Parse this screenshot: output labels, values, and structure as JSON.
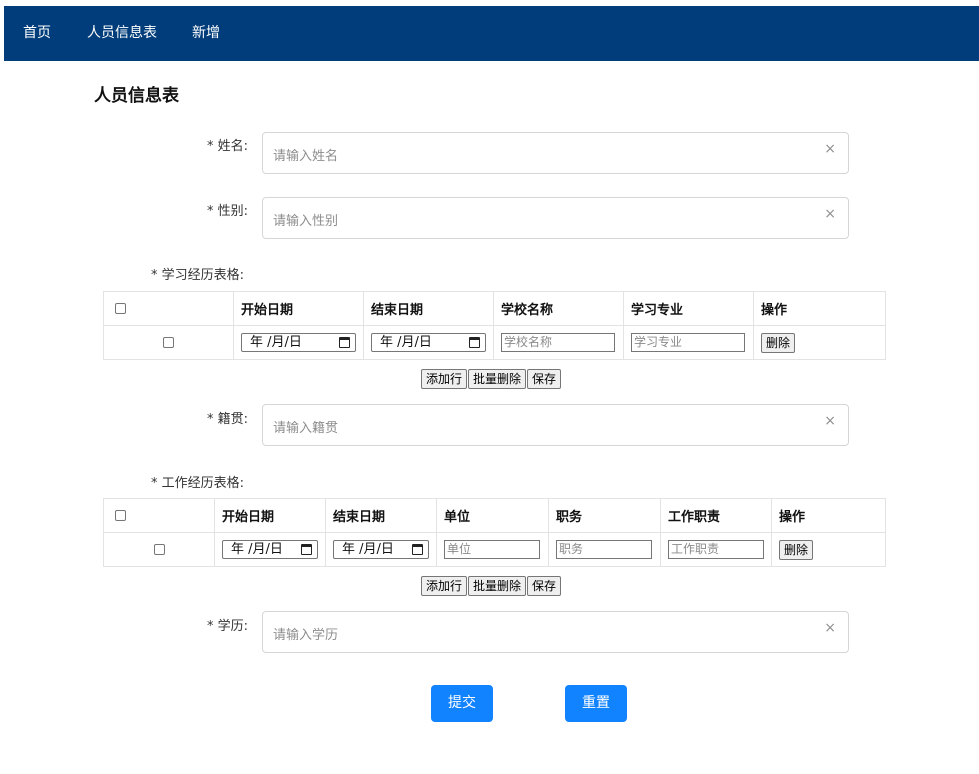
{
  "nav": {
    "home": "首页",
    "people": "人员信息表",
    "add": "新增"
  },
  "page_title": "人员信息表",
  "fields": {
    "name": {
      "label": "* 姓名:",
      "placeholder": "请输入姓名"
    },
    "gender": {
      "label": "* 性别:",
      "placeholder": "请输入性别"
    },
    "native": {
      "label": "* 籍贯:",
      "placeholder": "请输入籍贯"
    },
    "education": {
      "label": "* 学历:",
      "placeholder": "请输入学历"
    },
    "clear_icon": "×"
  },
  "study": {
    "label": "* 学习经历表格:",
    "headers": [
      "开始日期",
      "结束日期",
      "学校名称",
      "学习专业",
      "操作"
    ],
    "row": {
      "start": "年 /月/日",
      "end": "年 /月/日",
      "school_ph": "学校名称",
      "major_ph": "学习专业",
      "delete": "删除"
    }
  },
  "work": {
    "label": "* 工作经历表格:",
    "headers": [
      "开始日期",
      "结束日期",
      "单位",
      "职务",
      "工作职责",
      "操作"
    ],
    "row": {
      "start": "年 /月/日",
      "end": "年 /月/日",
      "unit_ph": "单位",
      "position_ph": "职务",
      "duty_ph": "工作职责",
      "delete": "删除"
    }
  },
  "table_buttons": {
    "add_row": "添加行",
    "batch_delete": "批量删除",
    "save": "保存"
  },
  "actions": {
    "submit": "提交",
    "reset": "重置"
  },
  "colors": {
    "nav": "#003d7a",
    "primary": "#1283ff"
  }
}
